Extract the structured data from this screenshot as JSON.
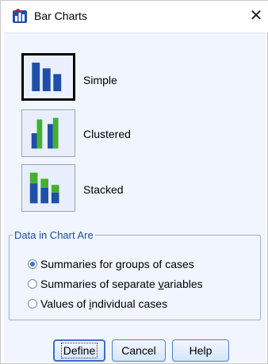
{
  "window": {
    "title": "Bar Charts",
    "close_glyph": "✕",
    "icon": "bar-chart-app-icon"
  },
  "chart_types": [
    {
      "label": "Simple",
      "icon": "simple-bar-chart-icon",
      "selected": true
    },
    {
      "label": "Clustered",
      "icon": "clustered-bar-chart-icon",
      "selected": false
    },
    {
      "label": "Stacked",
      "icon": "stacked-bar-chart-icon",
      "selected": false
    }
  ],
  "data_group": {
    "legend": "Data in Chart Are",
    "options": [
      {
        "pre": "Summaries for ",
        "mnemonic": "g",
        "post": "roups of cases",
        "selected": true
      },
      {
        "pre": "Summaries of separate ",
        "mnemonic": "v",
        "post": "ariables",
        "selected": false
      },
      {
        "pre": "Values of ",
        "mnemonic": "i",
        "post": "ndividual cases",
        "selected": false
      }
    ]
  },
  "buttons": {
    "define": "Define",
    "cancel": "Cancel",
    "help": "Help"
  },
  "colors": {
    "bar_blue": "#1f4fa8",
    "bar_green": "#45b02f",
    "accent": "#3b6fd8"
  }
}
